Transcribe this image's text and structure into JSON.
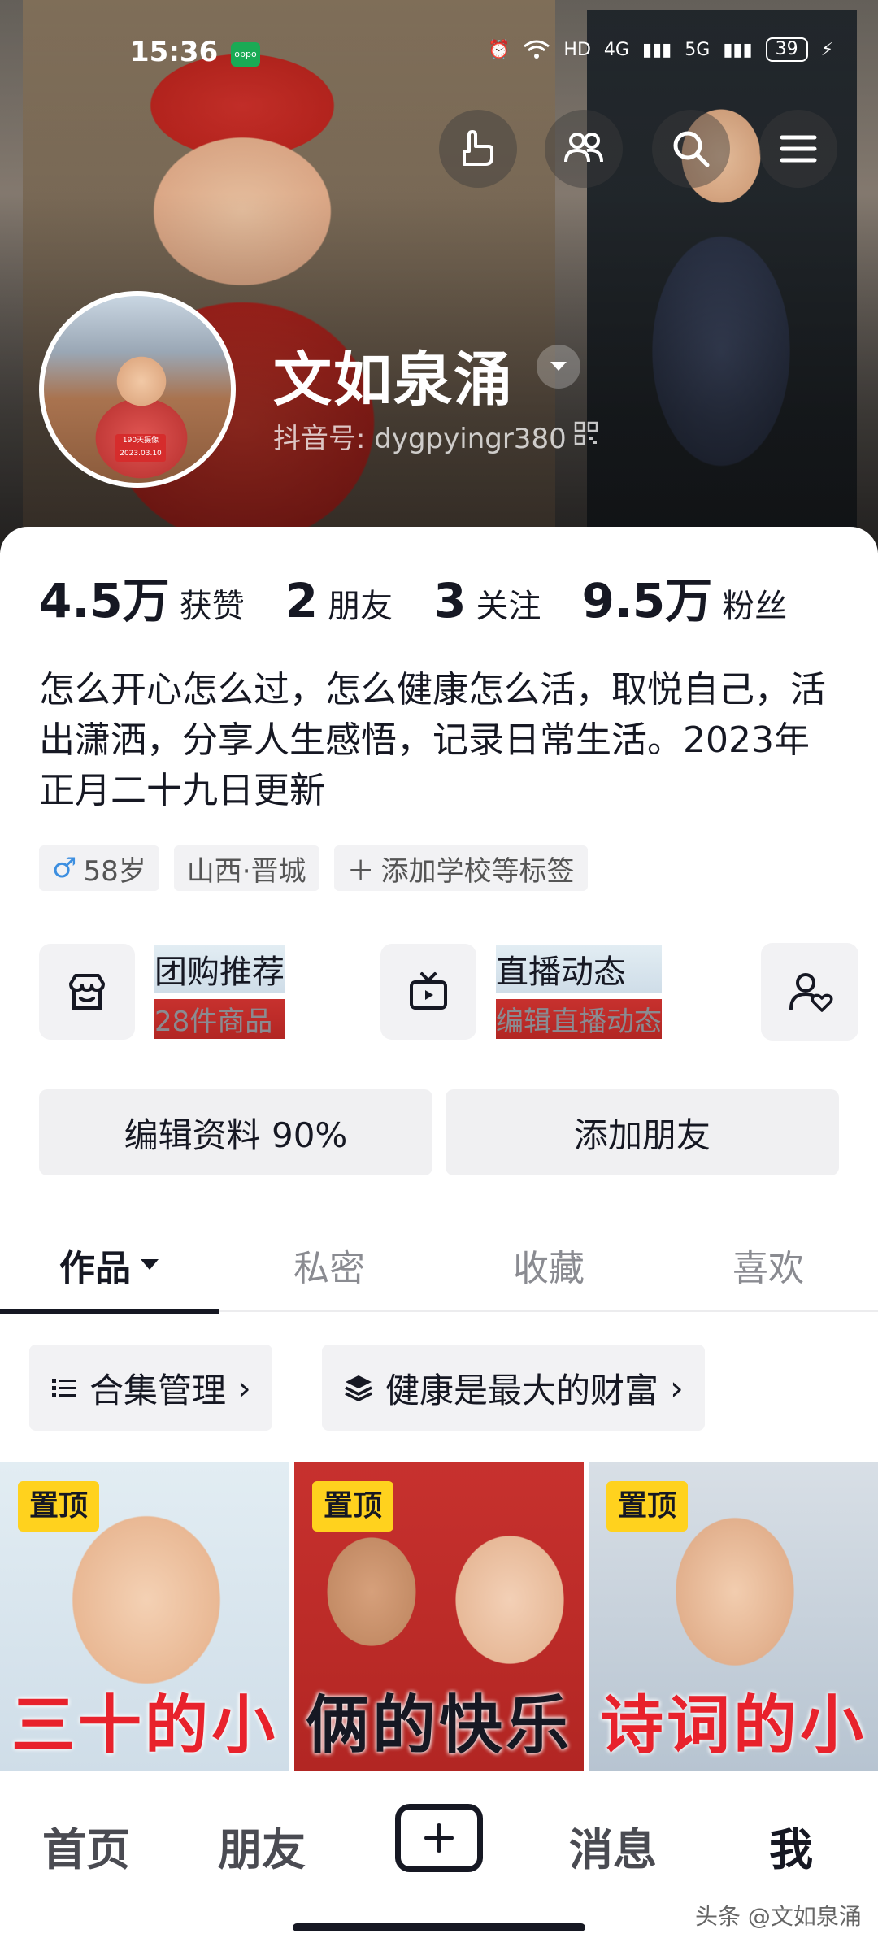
{
  "status_bar": {
    "time": "15:36",
    "network_a": "HD",
    "network_b": "4G",
    "network_c": "5G",
    "battery": "39"
  },
  "profile": {
    "name": "文如泉涌",
    "douyin_id": "抖音号: dygpyingr380",
    "avatar_tag_line1": "190天摄像",
    "avatar_tag_line2": "2023.03.10",
    "stats": [
      {
        "num": "4.5万",
        "label": "获赞"
      },
      {
        "num": "2",
        "label": "朋友"
      },
      {
        "num": "3",
        "label": "关注"
      },
      {
        "num": "9.5万",
        "label": "粉丝"
      }
    ],
    "bio": "怎么开心怎么过，怎么健康怎么活，取悦自己，活出潇洒，分享人生感悟，记录日常生活。2023年正月二十九日更新",
    "tags": {
      "age": "58岁",
      "location": "山西·晋城",
      "add": "添加学校等标签"
    }
  },
  "services": {
    "group_buy_title": "团购推荐",
    "group_buy_sub": "28件商品",
    "live_title": "直播动态",
    "live_sub": "编辑直播动态"
  },
  "buttons": {
    "edit_profile": "编辑资料 90%",
    "add_friend": "添加朋友"
  },
  "tabs": [
    "作品",
    "私密",
    "收藏",
    "喜欢"
  ],
  "chips": {
    "collection": "合集管理",
    "playlist": "健康是最大的财富"
  },
  "videos": [
    {
      "pin": "置顶",
      "caption": "三十的小"
    },
    {
      "pin": "置顶",
      "caption": "俩的快乐"
    },
    {
      "pin": "置顶",
      "caption": "诗词的小"
    }
  ],
  "nav": {
    "home": "首页",
    "friends": "朋友",
    "messages": "消息",
    "me": "我"
  },
  "watermark": "头条 @文如泉涌",
  "colors": {
    "pin_badge": "#ffd21e",
    "caption_red": "#e8222c",
    "male_blue": "#3d8fe0"
  }
}
